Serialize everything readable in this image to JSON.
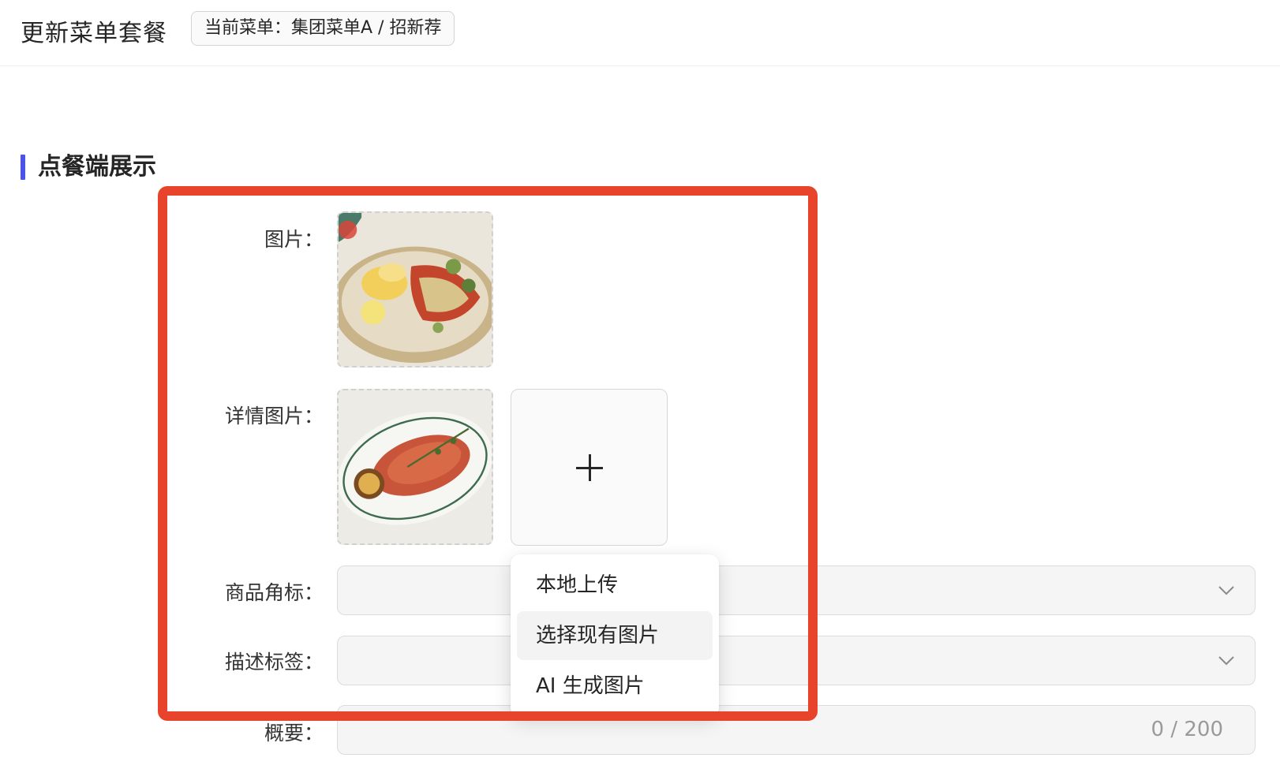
{
  "header": {
    "title": "更新菜单套餐",
    "menu_tag": "当前菜单：集团菜单A / 招新荐"
  },
  "section": {
    "title": "点餐端展示"
  },
  "form": {
    "image_label": "图片：",
    "detail_image_label": "详情图片：",
    "badge_label": "商品角标：",
    "tags_label": "描述标签：",
    "summary_label": "概要：",
    "summary_counter": "0 / 200"
  },
  "upload_menu": {
    "items": [
      {
        "label": "本地上传"
      },
      {
        "label": "选择现有图片"
      },
      {
        "label": "AI 生成图片"
      }
    ]
  },
  "icons": {
    "add": "plus-icon",
    "dropdown": "chevron-down-icon"
  },
  "colors": {
    "accent": "#4a55e8",
    "highlight": "#e8432b"
  }
}
